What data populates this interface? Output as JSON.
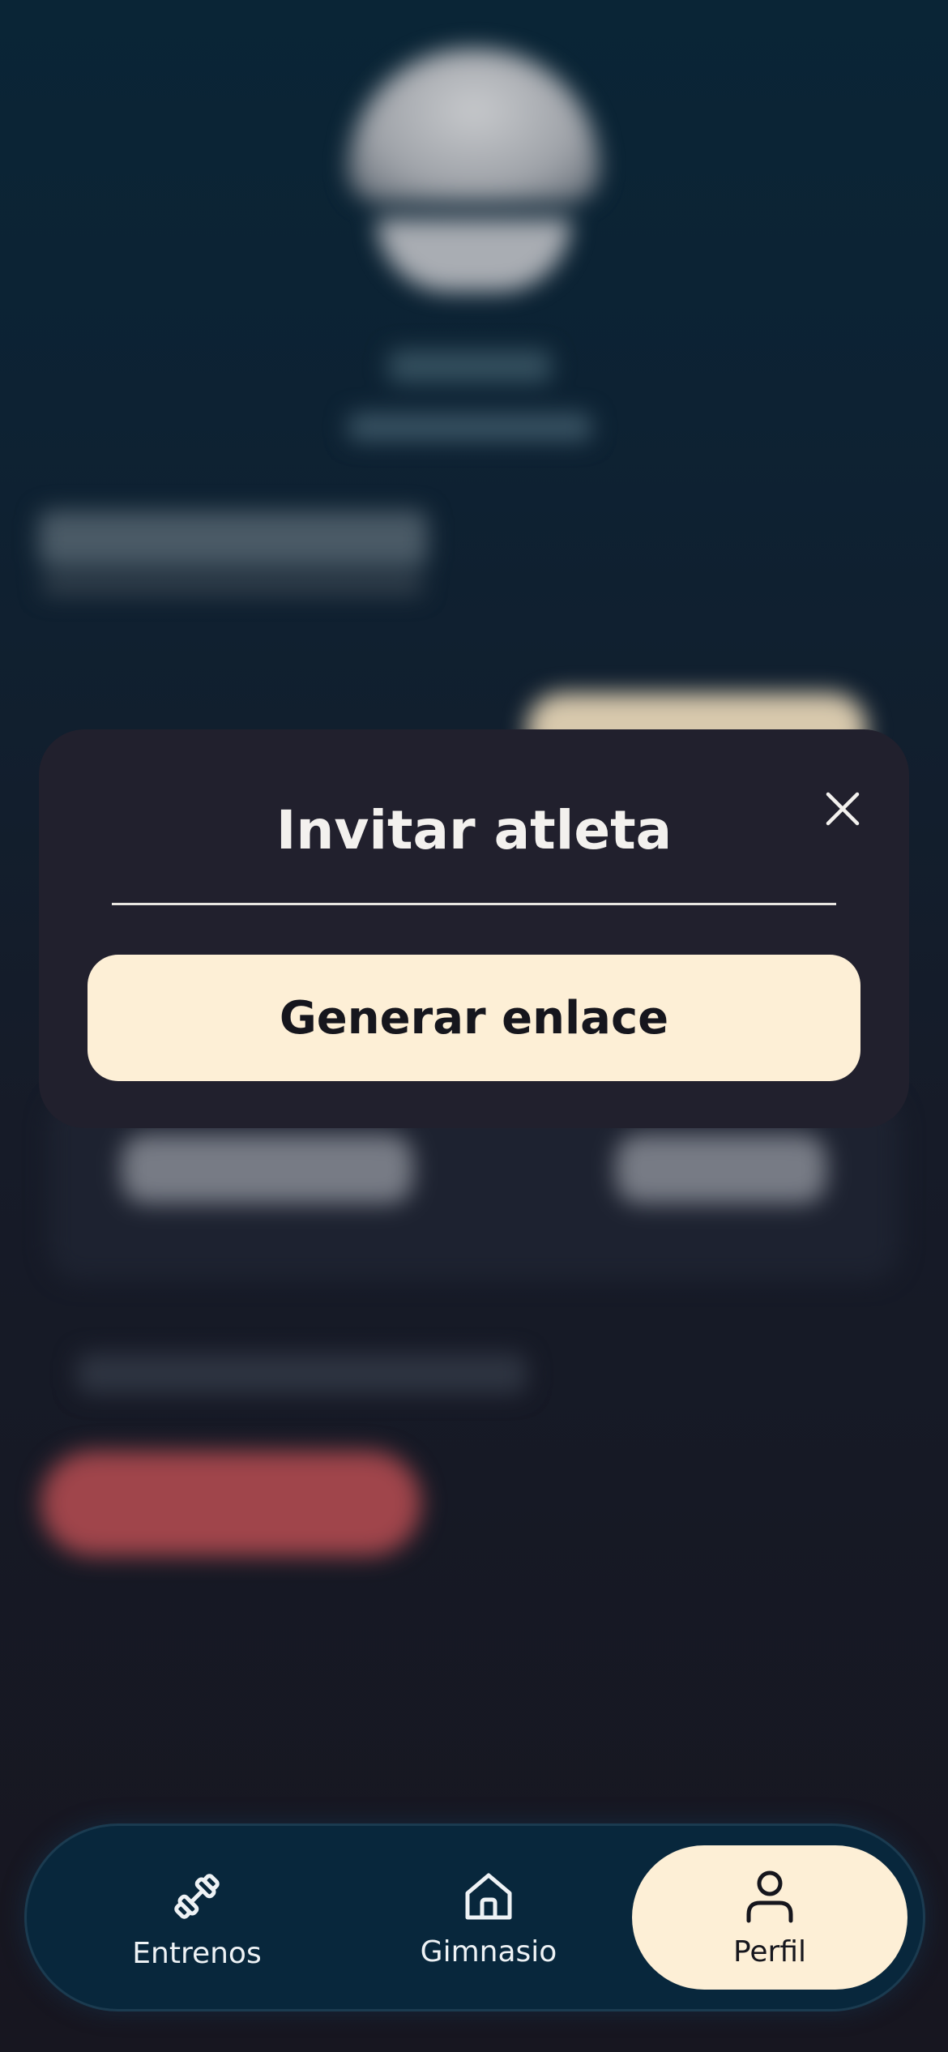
{
  "modal": {
    "title": "Invitar atleta",
    "close_icon": "close-icon",
    "primary_button_label": "Generar enlace"
  },
  "tabbar": {
    "tabs": [
      {
        "label": "Entrenos",
        "icon": "dumbbell-icon",
        "active": false
      },
      {
        "label": "Gimnasio",
        "icon": "home-icon",
        "active": false
      },
      {
        "label": "Perfil",
        "icon": "user-icon",
        "active": true
      }
    ]
  },
  "colors": {
    "modal_background": "#21202d",
    "accent_cream": "#fdefd6",
    "tabbar_background": "#08273c",
    "danger_red": "#a0454b"
  }
}
